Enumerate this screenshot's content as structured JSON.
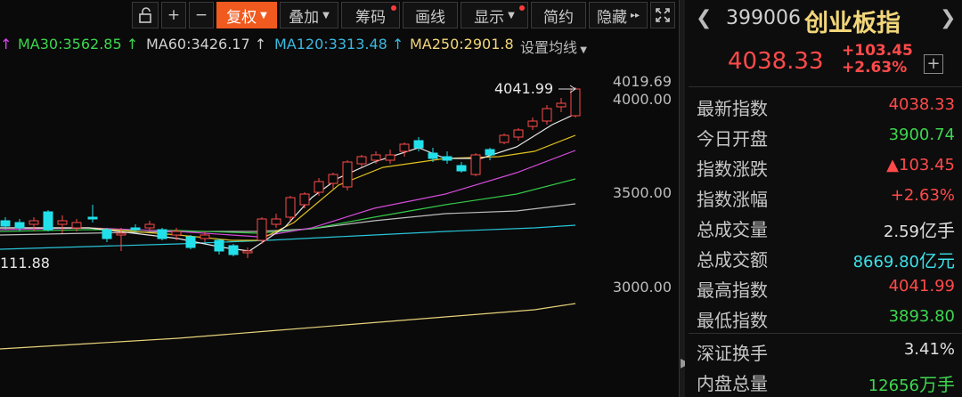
{
  "toolbar": {
    "buttons": [
      "复权",
      "叠加",
      "筹码",
      "画线",
      "显示",
      "简约",
      "隐藏"
    ]
  },
  "ma_legend": [
    {
      "text": "MA30:3562.85",
      "color": "#3dd64f"
    },
    {
      "text": "MA60:3426.17",
      "color": "#d0d0d0"
    },
    {
      "text": "MA120:3313.48",
      "color": "#3ab8e0"
    },
    {
      "text": "MA250:2901.8",
      "color": "#f2d67a"
    }
  ],
  "ma_settings": "设置均线",
  "price_axis": {
    "top_value": "4019.69",
    "ticks": [
      "4000.00",
      "3500.00",
      "3000.00"
    ]
  },
  "annotations": {
    "high": "4041.99",
    "low": "111.88"
  },
  "quote": {
    "code": "399006",
    "name": "创业板指",
    "price": "4038.33",
    "change": "+103.45",
    "change_pct": "+2.63%",
    "rows": [
      {
        "label": "最新指数",
        "value": "4038.33",
        "color": "red"
      },
      {
        "label": "今日开盘",
        "value": "3900.74",
        "color": "green"
      },
      {
        "label": "指数涨跌",
        "value": "▲103.45",
        "color": "red"
      },
      {
        "label": "指数涨幅",
        "value": "+2.63%",
        "color": "red"
      },
      {
        "label": "总成交量",
        "value": "2.59",
        "unit": "亿手",
        "color": "white"
      },
      {
        "label": "总成交额",
        "value": "8669.80",
        "unit": "亿元",
        "color": "cyan"
      },
      {
        "label": "最高指数",
        "value": "4041.99",
        "color": "red"
      },
      {
        "label": "最低指数",
        "value": "3893.80",
        "color": "green"
      },
      {
        "label": "深证换手",
        "value": "3.41%",
        "color": "white"
      },
      {
        "label": "内盘总量",
        "value": "12656",
        "unit": "万手",
        "color": "green"
      }
    ]
  },
  "colors": {
    "up": "#ff4a4a",
    "down": "#22e0ea",
    "accent": "#f05a1e"
  }
}
